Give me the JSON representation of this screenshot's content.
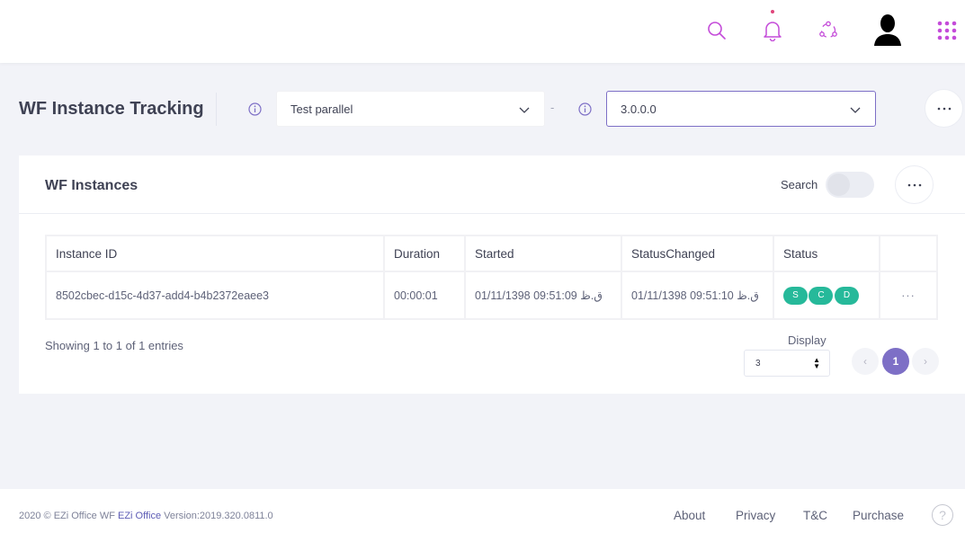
{
  "topbar": {
    "icons": [
      "search-icon",
      "bell-icon",
      "share-icon",
      "user-avatar-icon",
      "apps-grid-icon"
    ],
    "accent": "#c44bd9"
  },
  "subheader": {
    "title": "WF Instance Tracking",
    "workflow_select": {
      "value": "Test parallel"
    },
    "separator": "-",
    "version_select": {
      "value": "3.0.0.0"
    }
  },
  "card": {
    "title": "WF Instances",
    "search_label": "Search",
    "search_toggle_on": false,
    "table": {
      "columns": [
        "Instance ID",
        "Duration",
        "Started",
        "StatusChanged",
        "Status"
      ],
      "rows": [
        {
          "instance_id": "8502cbec-d15c-4d37-add4-b4b2372eaee3",
          "duration": "00:00:01",
          "started": "01/11/1398 09:51:09 ق.ظ",
          "status_changed": "01/11/1398 09:51:10 ق.ظ",
          "status_badges": [
            "S",
            "C",
            "D"
          ],
          "more": "···"
        }
      ]
    },
    "showing": "Showing 1 to 1 of 1 entries",
    "display_label": "Display",
    "display_value": "3",
    "pagination": {
      "prev": "‹",
      "current": "1",
      "next": "›"
    }
  },
  "footer": {
    "copyright_prefix": "2020 © EZi Office WF",
    "brand": "EZi Office",
    "version": "Version:2019.320.0811.0",
    "links": [
      "About",
      "Privacy",
      "T&C",
      "Purchase"
    ],
    "help": "?"
  },
  "colors": {
    "primary": "#7d6fc6",
    "status_badge": "#26b99a",
    "background": "#f2f3f8"
  }
}
